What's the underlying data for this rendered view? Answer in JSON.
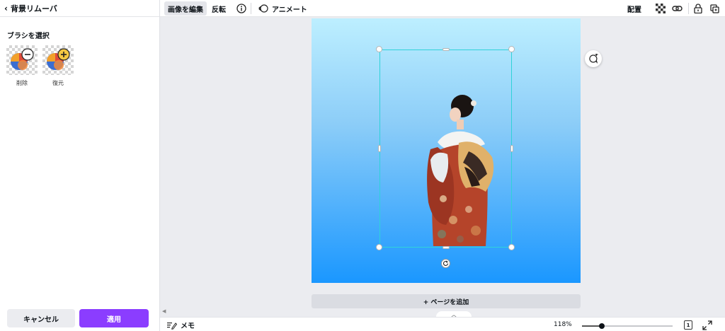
{
  "left_panel": {
    "back_label": "背景リムーバ",
    "section_title": "ブラシを選択",
    "brushes": [
      {
        "label": "削除",
        "icon": "minus-icon"
      },
      {
        "label": "復元",
        "icon": "plus-icon"
      }
    ],
    "cancel_label": "キャンセル",
    "apply_label": "適用"
  },
  "toolbar": {
    "edit_image_label": "画像を編集",
    "flip_label": "反転",
    "animate_label": "アニメート",
    "arrange_label": "配置"
  },
  "canvas": {
    "add_page_label": "+ ページを追加"
  },
  "bottom_bar": {
    "memo_label": "メモ",
    "zoom_label": "118%",
    "zoom_fraction": 0.22,
    "page_count": "1"
  },
  "colors": {
    "accent": "#8b3dff",
    "selection": "#2fd2d9",
    "gradient_top": "#bdefff",
    "gradient_bottom": "#1a97ff"
  }
}
